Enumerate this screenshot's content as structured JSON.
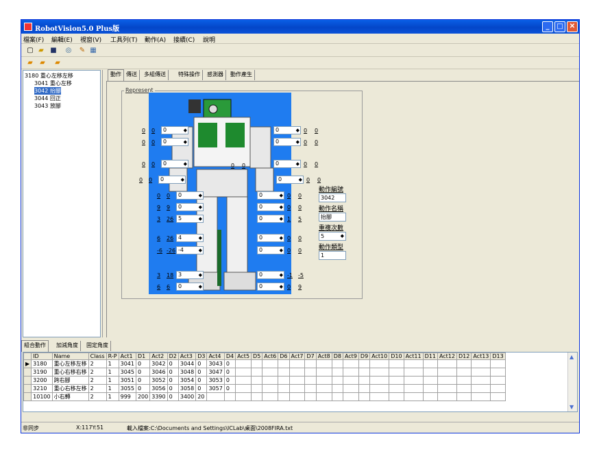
{
  "window": {
    "title": "RobotVision5.0 Plus版"
  },
  "menu": [
    "檔案(F)",
    "編輯(E)",
    "視窗(V)",
    "工具列(T)",
    "動作(A)",
    "接續(C)",
    "說明"
  ],
  "tree": {
    "root": "3180 重心左移左移",
    "children": [
      {
        "label": "3041 重心左移",
        "selected": false
      },
      {
        "label": "3042 抬腳",
        "selected": true
      },
      {
        "label": "3044 回正",
        "selected": false
      },
      {
        "label": "3043 放腳",
        "selected": false
      }
    ]
  },
  "tabs": [
    "動作",
    "傳送",
    "多組傳送",
    "特殊操作",
    "感測器",
    "動作產生"
  ],
  "group_label": "Represent",
  "joints": [
    {
      "a": "0",
      "b": "0",
      "v": "0"
    },
    {
      "a": "0",
      "b": "0",
      "v": "0"
    },
    {
      "a": "0",
      "b": "0",
      "v": "0"
    },
    {
      "a": "0",
      "b": "0",
      "v": "0"
    },
    {
      "a": "0",
      "b": "0",
      "v": "0"
    },
    {
      "a": "0",
      "b": "0",
      "v": "0"
    },
    {
      "a": "0",
      "b": "0",
      "v": "0"
    },
    {
      "a": "0",
      "b": "0",
      "v": "0"
    },
    {
      "a": "0",
      "b": "0",
      "v": "0"
    },
    {
      "a": "0",
      "b": "0",
      "v": "0"
    },
    {
      "a": "9",
      "b": "9",
      "v": "0"
    },
    {
      "a": "0",
      "b": "0",
      "v": "0"
    },
    {
      "a": "3",
      "b": "26",
      "v": "5"
    },
    {
      "a": "1",
      "b": "5",
      "v": "0"
    },
    {
      "a": "6",
      "b": "26",
      "v": "4"
    },
    {
      "a": "0",
      "b": "0",
      "v": "0"
    },
    {
      "a": "-6",
      "b": "-26",
      "v": "-4"
    },
    {
      "a": "0",
      "b": "0",
      "v": "0"
    },
    {
      "a": "3",
      "b": "18",
      "v": "3"
    },
    {
      "a": "-1",
      "b": "-5",
      "v": "0"
    },
    {
      "a": "6",
      "b": "6",
      "v": "0"
    },
    {
      "a": "0",
      "b": "9",
      "v": "0"
    }
  ],
  "side_right": [
    "0",
    "0",
    "0",
    "0",
    "0",
    "0",
    "0",
    "0",
    "0",
    "0",
    "0"
  ],
  "robot_center": [
    "0",
    "0"
  ],
  "props": {
    "action_no_label": "動作編號",
    "action_no": "3042",
    "action_name_label": "動作名稱",
    "action_name": "抬腳",
    "repeat_label": "重複次數",
    "repeat": "5",
    "type_label": "動作類型",
    "type": "1"
  },
  "bottom_tabs": [
    "組合動作",
    "加減角度",
    "固定角度"
  ],
  "grid": {
    "headers": [
      "ID",
      "Name",
      "Class",
      "R-P",
      "Act1",
      "D1",
      "Act2",
      "D2",
      "Act3",
      "D3",
      "Act4",
      "D4",
      "Act5",
      "D5",
      "Act6",
      "D6",
      "Act7",
      "D7",
      "Act8",
      "D8",
      "Act9",
      "D9",
      "Act10",
      "D10",
      "Act11",
      "D11",
      "Act12",
      "D12",
      "Act13",
      "D13"
    ],
    "rows": [
      [
        "3180",
        "重心左移左移",
        "2",
        "1",
        "3041",
        "0",
        "3042",
        "0",
        "3044",
        "0",
        "3043",
        "0"
      ],
      [
        "3190",
        "重心右移右移",
        "2",
        "1",
        "3045",
        "0",
        "3046",
        "0",
        "3048",
        "0",
        "3047",
        "0"
      ],
      [
        "3200",
        "跨右腳",
        "2",
        "1",
        "3051",
        "0",
        "3052",
        "0",
        "3054",
        "0",
        "3053",
        "0"
      ],
      [
        "3210",
        "重心右移左移",
        "2",
        "1",
        "3055",
        "0",
        "3056",
        "0",
        "3058",
        "0",
        "3057",
        "0"
      ],
      [
        "10100",
        "小右轉",
        "2",
        "1",
        "999",
        "200",
        "3390",
        "0",
        "3400",
        "20"
      ]
    ]
  },
  "status": {
    "left": "非同步",
    "coords": "X:117Y:51",
    "msg": "載入檔案:C:\\Documents and Settings\\ICLab\\桌面\\2008FIRA.txt"
  }
}
